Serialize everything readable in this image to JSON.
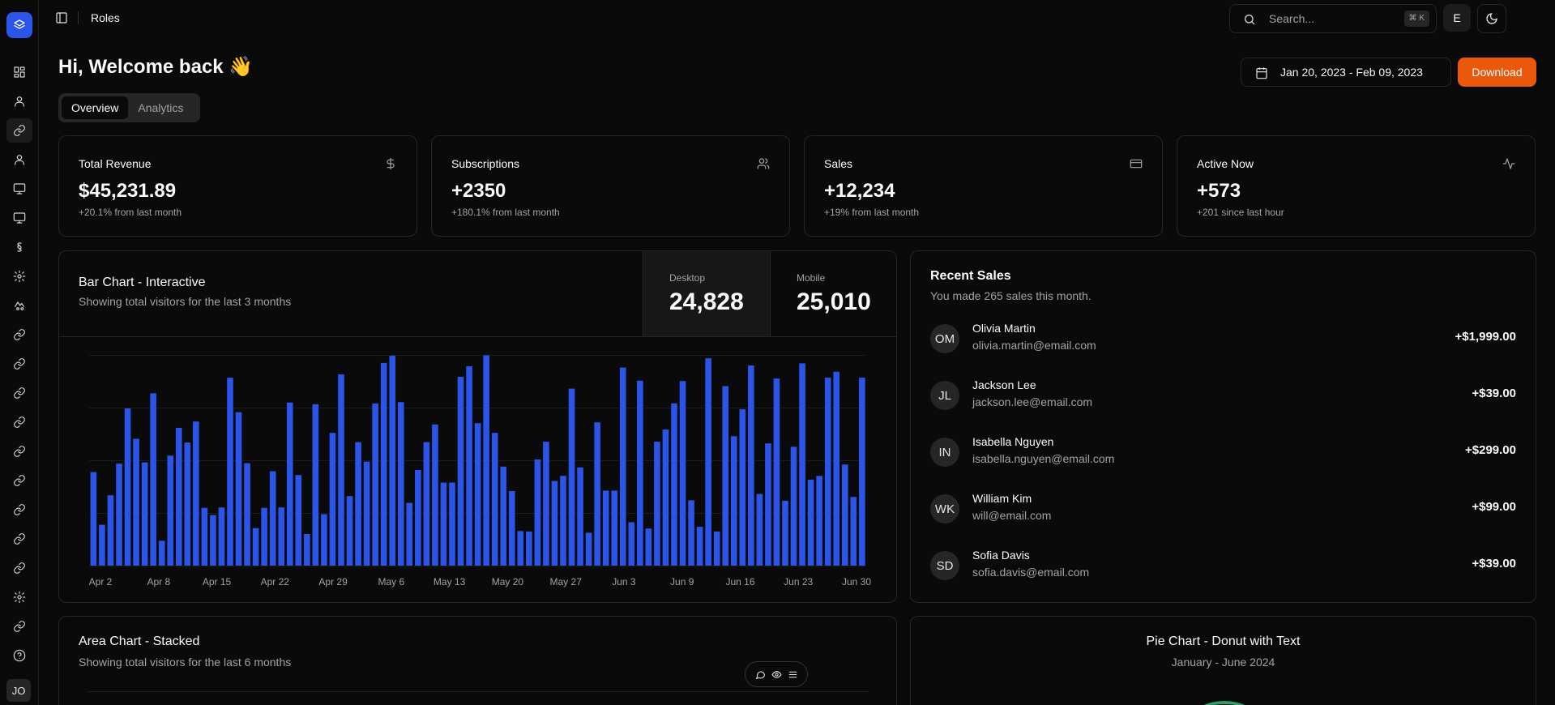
{
  "header": {
    "breadcrumb": "Roles",
    "search_placeholder": "Search...",
    "search_shortcut": "⌘ K",
    "user_initial": "E"
  },
  "sidebar": {
    "user_initials": "JO",
    "items": [
      "dashboard-icon",
      "user-icon",
      "link-icon",
      "user-icon",
      "monitor-icon",
      "monitor-icon",
      "section-icon",
      "gear-icon",
      "bug-icon",
      "link-icon",
      "link-icon",
      "link-icon",
      "link-icon",
      "link-icon",
      "link-icon",
      "link-icon",
      "link-icon",
      "link-icon",
      "gear-icon",
      "link-icon",
      "help-icon"
    ]
  },
  "welcome": {
    "greeting": "Hi, Welcome back 👋",
    "tabs": [
      "Overview",
      "Analytics"
    ],
    "date_range": "Jan 20, 2023 - Feb 09, 2023",
    "download_label": "Download"
  },
  "stats": [
    {
      "label": "Total Revenue",
      "value": "$45,231.89",
      "sub": "+20.1% from last month",
      "icon": "dollar-icon"
    },
    {
      "label": "Subscriptions",
      "value": "+2350",
      "sub": "+180.1% from last month",
      "icon": "users-icon"
    },
    {
      "label": "Sales",
      "value": "+12,234",
      "sub": "+19% from last month",
      "icon": "credit-card-icon"
    },
    {
      "label": "Active Now",
      "value": "+573",
      "sub": "+201 since last hour",
      "icon": "activity-icon"
    }
  ],
  "bar_card": {
    "title": "Bar Chart - Interactive",
    "subtitle": "Showing total visitors for the last 3 months",
    "metrics": [
      {
        "label": "Desktop",
        "value": "24,828"
      },
      {
        "label": "Mobile",
        "value": "25,010"
      }
    ]
  },
  "chart_data": {
    "type": "bar",
    "title": "Bar Chart - Interactive",
    "x_tick_labels": [
      "Apr 2",
      "Apr 8",
      "Apr 15",
      "Apr 22",
      "Apr 29",
      "May 6",
      "May 13",
      "May 20",
      "May 27",
      "Jun 3",
      "Jun 9",
      "Jun 16",
      "Jun 23",
      "Jun 30"
    ],
    "ylim": [
      0,
      500
    ],
    "grid": true,
    "color": "#2b55e8",
    "series": [
      {
        "values": [
          222,
          97,
          167,
          242,
          373,
          301,
          245,
          409,
          59,
          261,
          327,
          292,
          342,
          137,
          120,
          138,
          446,
          364,
          243,
          89,
          137,
          224,
          138,
          387,
          215,
          75,
          383,
          122,
          315,
          454,
          165,
          293,
          247,
          385,
          481,
          498,
          388,
          149,
          227,
          293,
          335,
          197,
          197,
          448,
          473,
          338,
          499,
          315,
          235,
          177,
          82,
          81,
          252,
          294,
          201,
          213,
          420,
          233,
          78,
          340,
          178,
          178,
          470,
          103,
          439,
          88,
          294,
          323,
          385,
          438,
          155,
          92,
          492,
          81,
          426,
          307,
          371,
          475,
          170,
          290,
          444,
          154,
          282,
          480,
          204,
          213,
          446,
          460,
          240,
          163,
          446
        ]
      }
    ]
  },
  "sales": {
    "title": "Recent Sales",
    "subtitle": "You made 265 sales this month.",
    "items": [
      {
        "initials": "OM",
        "name": "Olivia Martin",
        "email": "olivia.martin@email.com",
        "amount": "+$1,999.00"
      },
      {
        "initials": "JL",
        "name": "Jackson Lee",
        "email": "jackson.lee@email.com",
        "amount": "+$39.00"
      },
      {
        "initials": "IN",
        "name": "Isabella Nguyen",
        "email": "isabella.nguyen@email.com",
        "amount": "+$299.00"
      },
      {
        "initials": "WK",
        "name": "William Kim",
        "email": "will@email.com",
        "amount": "+$99.00"
      },
      {
        "initials": "SD",
        "name": "Sofia Davis",
        "email": "sofia.davis@email.com",
        "amount": "+$39.00"
      }
    ]
  },
  "area_card": {
    "title": "Area Chart - Stacked",
    "subtitle": "Showing total visitors for the last 6 months"
  },
  "pie_card": {
    "title": "Pie Chart - Donut with Text",
    "subtitle": "January - June 2024"
  }
}
